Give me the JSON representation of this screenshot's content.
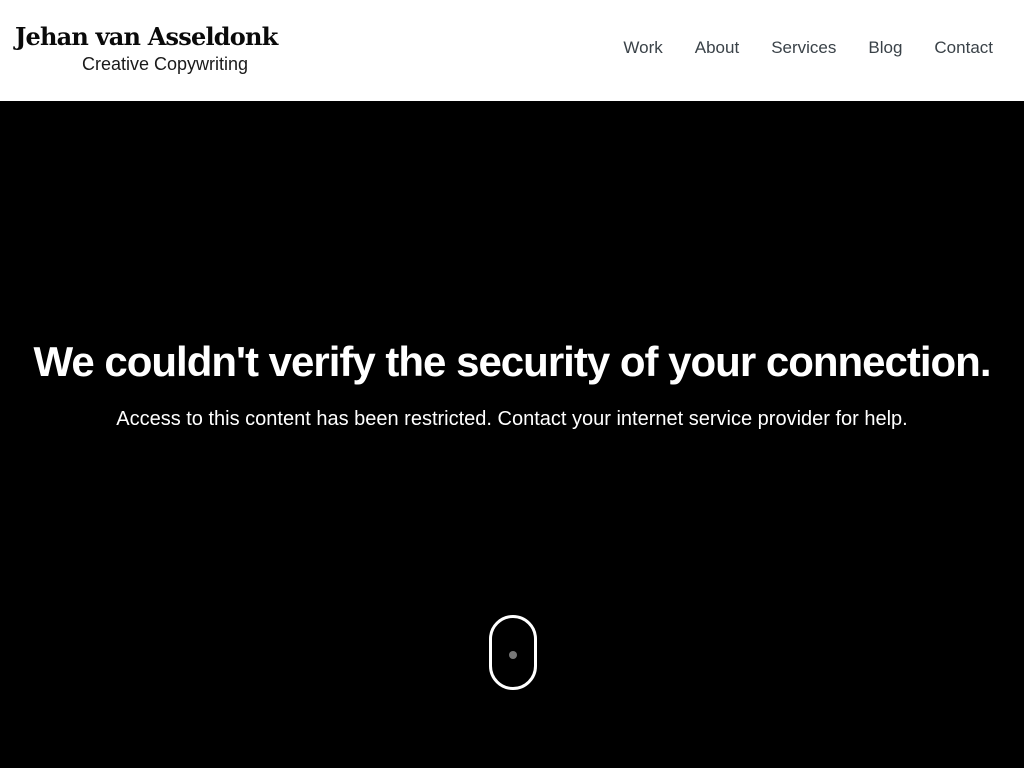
{
  "brand": {
    "name": "Jehan van Asseldonk",
    "tagline": "Creative Copywriting"
  },
  "nav": {
    "items": [
      {
        "label": "Work"
      },
      {
        "label": "About"
      },
      {
        "label": "Services"
      },
      {
        "label": "Blog"
      },
      {
        "label": "Contact"
      }
    ]
  },
  "hero": {
    "title": "We couldn't verify the security of your connection.",
    "subtitle": "Access to this content has been restricted. Contact your internet service provider for help."
  },
  "icons": {
    "scroll": "mouse-scroll-icon"
  },
  "colors": {
    "header_bg": "#ffffff",
    "hero_bg": "#000000",
    "nav_text": "#3a4248",
    "hero_text": "#ffffff"
  }
}
